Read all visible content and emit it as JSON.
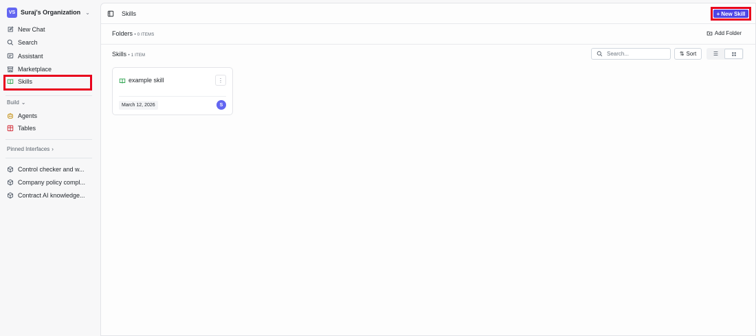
{
  "org": {
    "initials": "VS",
    "name": "Suraj's Organization"
  },
  "nav": {
    "new_chat": "New Chat",
    "search": "Search",
    "assistant": "Assistant",
    "marketplace": "Marketplace",
    "skills": "Skills"
  },
  "build": {
    "label": "Build",
    "agents": "Agents",
    "tables": "Tables"
  },
  "pinned": {
    "label": "Pinned Interfaces",
    "items": [
      {
        "label": "Control checker and w..."
      },
      {
        "label": "Company policy compl..."
      },
      {
        "label": "Contract AI knowledge..."
      }
    ]
  },
  "header": {
    "title": "Skills",
    "new_skill_label": "New Skill"
  },
  "folders": {
    "label": "Folders",
    "count": "0 ITEMS",
    "add_label": "Add Folder"
  },
  "skills_section": {
    "label": "Skills",
    "count": "1 ITEM",
    "search_placeholder": "Search...",
    "sort_label": "Sort"
  },
  "cards": [
    {
      "title": "example skill",
      "date": "March 12, 2026",
      "owner_initial": "S"
    }
  ],
  "colors": {
    "accent": "#4f46e5",
    "highlight": "#e8001c",
    "skills_icon": "#2da44e",
    "tables_icon": "#d1242f",
    "agents_icon": "#bf8700"
  }
}
